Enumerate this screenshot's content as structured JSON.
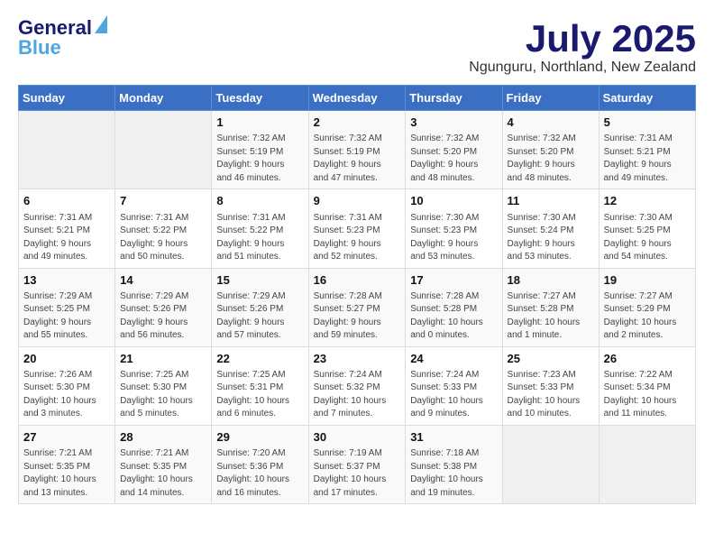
{
  "header": {
    "logo": {
      "line1": "General",
      "line2": "Blue",
      "url_text": "GeneralBlue"
    },
    "title": "July 2025",
    "subtitle": "Ngunguru, Northland, New Zealand"
  },
  "weekdays": [
    "Sunday",
    "Monday",
    "Tuesday",
    "Wednesday",
    "Thursday",
    "Friday",
    "Saturday"
  ],
  "weeks": [
    [
      {
        "day": "",
        "detail": ""
      },
      {
        "day": "",
        "detail": ""
      },
      {
        "day": "1",
        "detail": "Sunrise: 7:32 AM\nSunset: 5:19 PM\nDaylight: 9 hours\nand 46 minutes."
      },
      {
        "day": "2",
        "detail": "Sunrise: 7:32 AM\nSunset: 5:19 PM\nDaylight: 9 hours\nand 47 minutes."
      },
      {
        "day": "3",
        "detail": "Sunrise: 7:32 AM\nSunset: 5:20 PM\nDaylight: 9 hours\nand 48 minutes."
      },
      {
        "day": "4",
        "detail": "Sunrise: 7:32 AM\nSunset: 5:20 PM\nDaylight: 9 hours\nand 48 minutes."
      },
      {
        "day": "5",
        "detail": "Sunrise: 7:31 AM\nSunset: 5:21 PM\nDaylight: 9 hours\nand 49 minutes."
      }
    ],
    [
      {
        "day": "6",
        "detail": "Sunrise: 7:31 AM\nSunset: 5:21 PM\nDaylight: 9 hours\nand 49 minutes."
      },
      {
        "day": "7",
        "detail": "Sunrise: 7:31 AM\nSunset: 5:22 PM\nDaylight: 9 hours\nand 50 minutes."
      },
      {
        "day": "8",
        "detail": "Sunrise: 7:31 AM\nSunset: 5:22 PM\nDaylight: 9 hours\nand 51 minutes."
      },
      {
        "day": "9",
        "detail": "Sunrise: 7:31 AM\nSunset: 5:23 PM\nDaylight: 9 hours\nand 52 minutes."
      },
      {
        "day": "10",
        "detail": "Sunrise: 7:30 AM\nSunset: 5:23 PM\nDaylight: 9 hours\nand 53 minutes."
      },
      {
        "day": "11",
        "detail": "Sunrise: 7:30 AM\nSunset: 5:24 PM\nDaylight: 9 hours\nand 53 minutes."
      },
      {
        "day": "12",
        "detail": "Sunrise: 7:30 AM\nSunset: 5:25 PM\nDaylight: 9 hours\nand 54 minutes."
      }
    ],
    [
      {
        "day": "13",
        "detail": "Sunrise: 7:29 AM\nSunset: 5:25 PM\nDaylight: 9 hours\nand 55 minutes."
      },
      {
        "day": "14",
        "detail": "Sunrise: 7:29 AM\nSunset: 5:26 PM\nDaylight: 9 hours\nand 56 minutes."
      },
      {
        "day": "15",
        "detail": "Sunrise: 7:29 AM\nSunset: 5:26 PM\nDaylight: 9 hours\nand 57 minutes."
      },
      {
        "day": "16",
        "detail": "Sunrise: 7:28 AM\nSunset: 5:27 PM\nDaylight: 9 hours\nand 59 minutes."
      },
      {
        "day": "17",
        "detail": "Sunrise: 7:28 AM\nSunset: 5:28 PM\nDaylight: 10 hours\nand 0 minutes."
      },
      {
        "day": "18",
        "detail": "Sunrise: 7:27 AM\nSunset: 5:28 PM\nDaylight: 10 hours\nand 1 minute."
      },
      {
        "day": "19",
        "detail": "Sunrise: 7:27 AM\nSunset: 5:29 PM\nDaylight: 10 hours\nand 2 minutes."
      }
    ],
    [
      {
        "day": "20",
        "detail": "Sunrise: 7:26 AM\nSunset: 5:30 PM\nDaylight: 10 hours\nand 3 minutes."
      },
      {
        "day": "21",
        "detail": "Sunrise: 7:25 AM\nSunset: 5:30 PM\nDaylight: 10 hours\nand 5 minutes."
      },
      {
        "day": "22",
        "detail": "Sunrise: 7:25 AM\nSunset: 5:31 PM\nDaylight: 10 hours\nand 6 minutes."
      },
      {
        "day": "23",
        "detail": "Sunrise: 7:24 AM\nSunset: 5:32 PM\nDaylight: 10 hours\nand 7 minutes."
      },
      {
        "day": "24",
        "detail": "Sunrise: 7:24 AM\nSunset: 5:33 PM\nDaylight: 10 hours\nand 9 minutes."
      },
      {
        "day": "25",
        "detail": "Sunrise: 7:23 AM\nSunset: 5:33 PM\nDaylight: 10 hours\nand 10 minutes."
      },
      {
        "day": "26",
        "detail": "Sunrise: 7:22 AM\nSunset: 5:34 PM\nDaylight: 10 hours\nand 11 minutes."
      }
    ],
    [
      {
        "day": "27",
        "detail": "Sunrise: 7:21 AM\nSunset: 5:35 PM\nDaylight: 10 hours\nand 13 minutes."
      },
      {
        "day": "28",
        "detail": "Sunrise: 7:21 AM\nSunset: 5:35 PM\nDaylight: 10 hours\nand 14 minutes."
      },
      {
        "day": "29",
        "detail": "Sunrise: 7:20 AM\nSunset: 5:36 PM\nDaylight: 10 hours\nand 16 minutes."
      },
      {
        "day": "30",
        "detail": "Sunrise: 7:19 AM\nSunset: 5:37 PM\nDaylight: 10 hours\nand 17 minutes."
      },
      {
        "day": "31",
        "detail": "Sunrise: 7:18 AM\nSunset: 5:38 PM\nDaylight: 10 hours\nand 19 minutes."
      },
      {
        "day": "",
        "detail": ""
      },
      {
        "day": "",
        "detail": ""
      }
    ]
  ]
}
